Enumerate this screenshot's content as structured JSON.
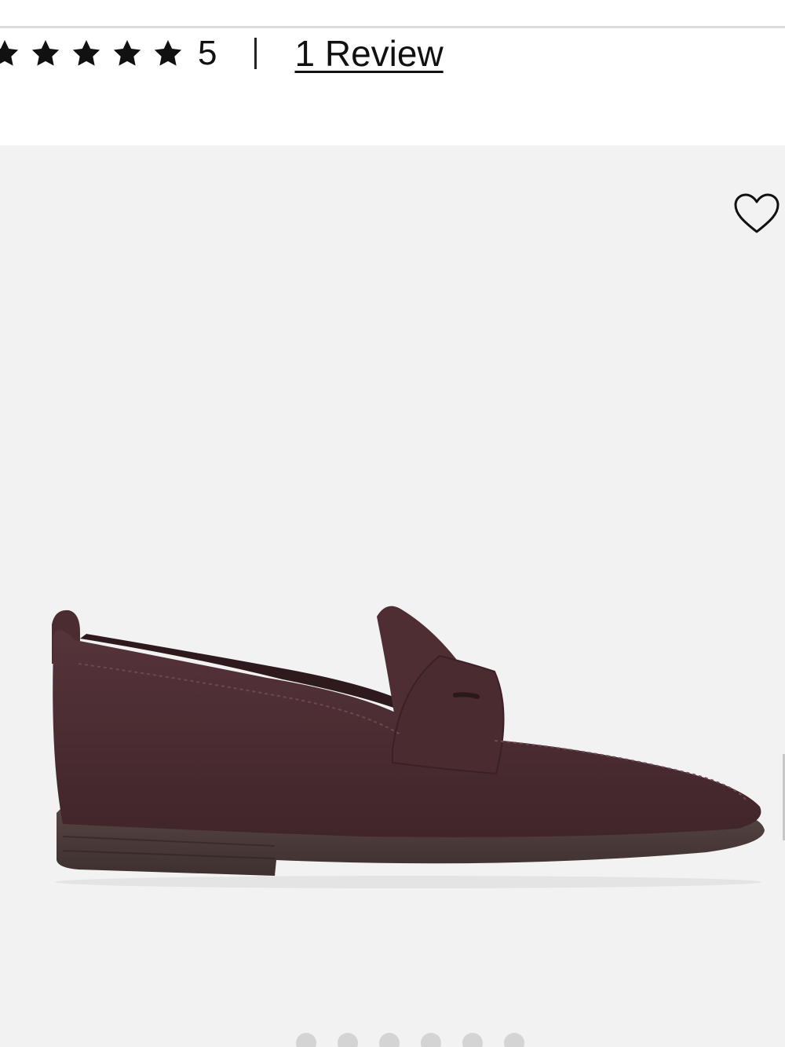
{
  "rating": {
    "stars": [
      1,
      1,
      1,
      1,
      1
    ],
    "value": "5",
    "review_link": "1 Review",
    "star_icon": "star-icon"
  },
  "gallery": {
    "wishlist_icon": "heart-outline-icon",
    "image_subject": "penny-loafer",
    "dots": [
      "",
      "",
      "",
      "",
      "",
      ""
    ],
    "active_dot": 0,
    "colors": {
      "background": "#f2f2f2",
      "shoe_upper": "#4a2c2f",
      "shoe_sole": "#4d3d3c",
      "dot": "#d4d4d4"
    }
  }
}
